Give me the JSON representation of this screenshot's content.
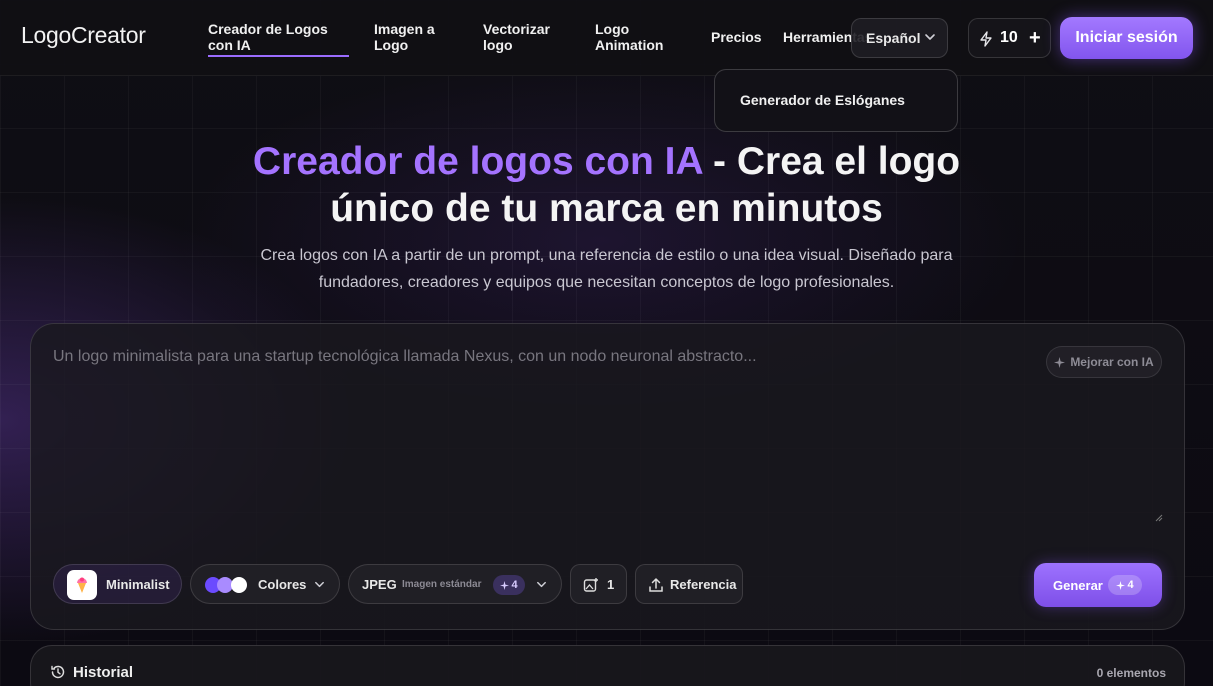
{
  "header": {
    "logo": "LogoCreator",
    "nav": [
      {
        "label": "Creador de Logos con IA",
        "active": true
      },
      {
        "label": "Imagen a Logo"
      },
      {
        "label": "Vectorizar logo"
      },
      {
        "label": "Logo Animation"
      },
      {
        "label": "Precios"
      },
      {
        "label": "Herramientas"
      }
    ],
    "language": "Español",
    "credits": "10",
    "login_label": "Iniciar sesión"
  },
  "tools_dropdown": {
    "items": [
      "Generador de Eslóganes"
    ]
  },
  "hero": {
    "title_accent": "Creador de logos con IA",
    "title_rest_1": " - Crea el logo",
    "title_rest_2": "único de tu marca en minutos",
    "subtitle_1": "Crea logos con IA a partir de un prompt, una referencia de estilo o una idea visual. Diseñado para",
    "subtitle_2": "fundadores, creadores y equipos que necesitan conceptos de logo profesionales."
  },
  "prompt": {
    "placeholder": "Un logo minimalista para una startup tecnológica llamada Nexus, con un nodo neuronal abstracto...",
    "improve_label": "Mejorar con IA"
  },
  "toolbar": {
    "style_label": "Minimalist",
    "colors_label": "Colores",
    "color_swatches": [
      "#6b4bff",
      "#a98bff",
      "#ffffff"
    ],
    "format_label": "JPEG",
    "quality_label": "Imagen estándar",
    "quality_cost": "4",
    "count_label": "1",
    "reference_label": "Referencia",
    "generate_label": "Generar",
    "generate_cost": "4"
  },
  "history": {
    "title": "Historial",
    "count": "0 elementos"
  },
  "colors": {
    "accent": "#a473ff",
    "background": "#0b0a10"
  }
}
